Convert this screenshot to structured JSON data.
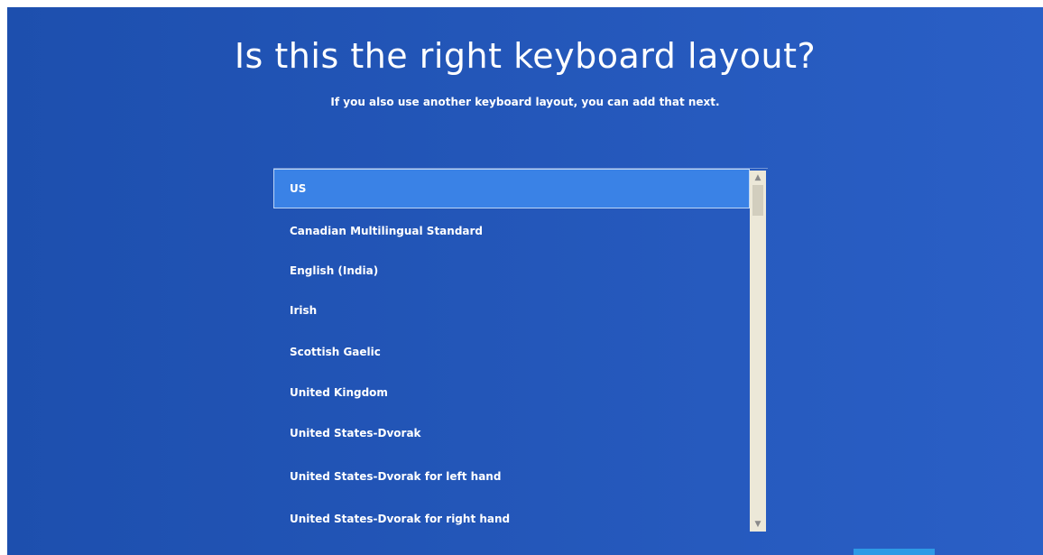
{
  "header": {
    "title": "Is this the right keyboard layout?",
    "subtitle": "If you also use another keyboard layout, you can add that next."
  },
  "layout_list": {
    "selected_index": 0,
    "items": [
      {
        "label": "US"
      },
      {
        "label": "Canadian Multilingual Standard"
      },
      {
        "label": "English (India)"
      },
      {
        "label": "Irish"
      },
      {
        "label": "Scottish Gaelic"
      },
      {
        "label": "United Kingdom"
      },
      {
        "label": "United States-Dvorak"
      },
      {
        "label": "United States-Dvorak for left hand"
      },
      {
        "label": "United States-Dvorak for right hand"
      }
    ]
  },
  "icons": {
    "scroll_up": "chevron-up-icon",
    "scroll_down": "chevron-down-icon"
  },
  "colors": {
    "background": "#2356b8",
    "selected_item": "#3a82e6",
    "scrollbar_track": "#ece8d8",
    "accent_bar": "#2e9ae6"
  }
}
